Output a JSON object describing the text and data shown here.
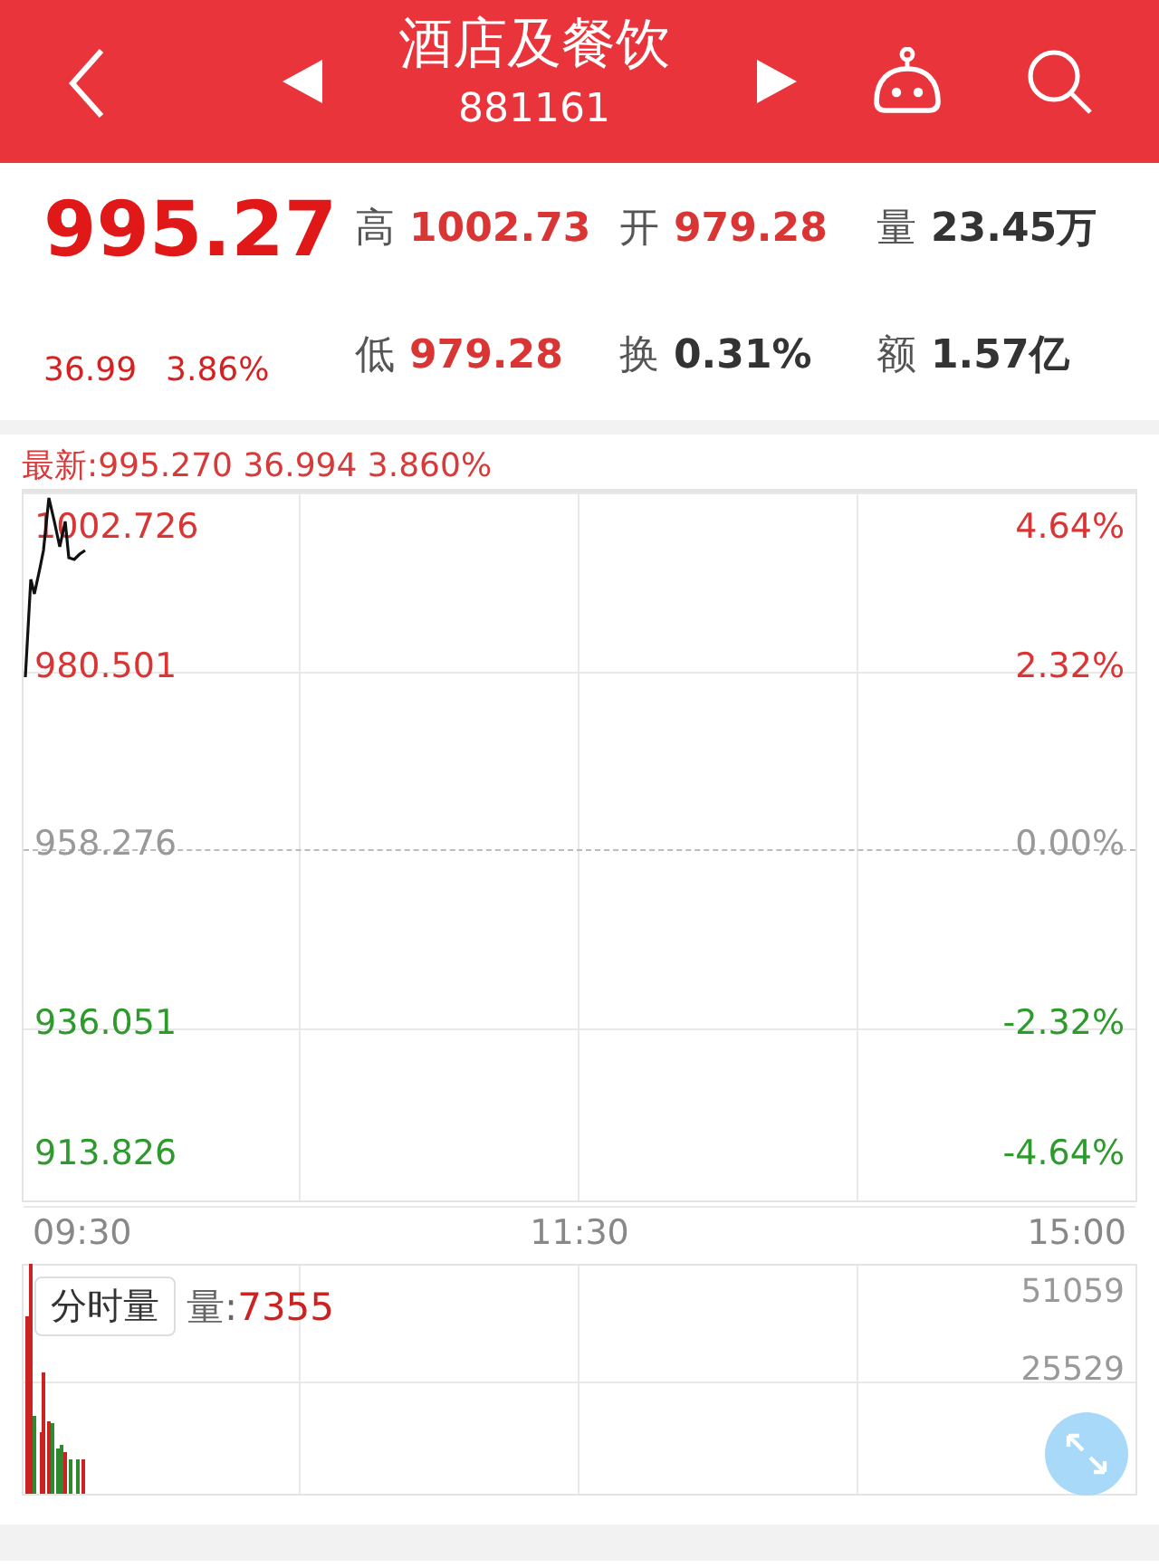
{
  "header": {
    "title": "酒店及餐饮",
    "code": "881161"
  },
  "quote": {
    "price": "995.27",
    "change": "36.99",
    "change_pct": "3.86%",
    "stats": [
      {
        "label": "高",
        "value": "1002.73",
        "kind": "up"
      },
      {
        "label": "开",
        "value": "979.28",
        "kind": "up"
      },
      {
        "label": "量",
        "value": "23.45万",
        "kind": "neutral"
      },
      {
        "label": "低",
        "value": "979.28",
        "kind": "up"
      },
      {
        "label": "换",
        "value": "0.31%",
        "kind": "neutral"
      },
      {
        "label": "额",
        "value": "1.57亿",
        "kind": "neutral"
      }
    ]
  },
  "latest": "最新:995.270 36.994 3.860%",
  "price_chart": {
    "levels": [
      {
        "price": "1002.726",
        "pct": "4.64%",
        "kind": "up"
      },
      {
        "price": "980.501",
        "pct": "2.32%",
        "kind": "up"
      },
      {
        "price": "958.276",
        "pct": "0.00%",
        "kind": "flat"
      },
      {
        "price": "936.051",
        "pct": "-2.32%",
        "kind": "down"
      },
      {
        "price": "913.826",
        "pct": "-4.64%",
        "kind": "down"
      }
    ],
    "times": [
      "09:30",
      "11:30",
      "15:00"
    ]
  },
  "volume_chart": {
    "tag": "分时量",
    "label": "量:",
    "value": "7355",
    "axis": [
      "51059",
      "25529"
    ]
  }
}
